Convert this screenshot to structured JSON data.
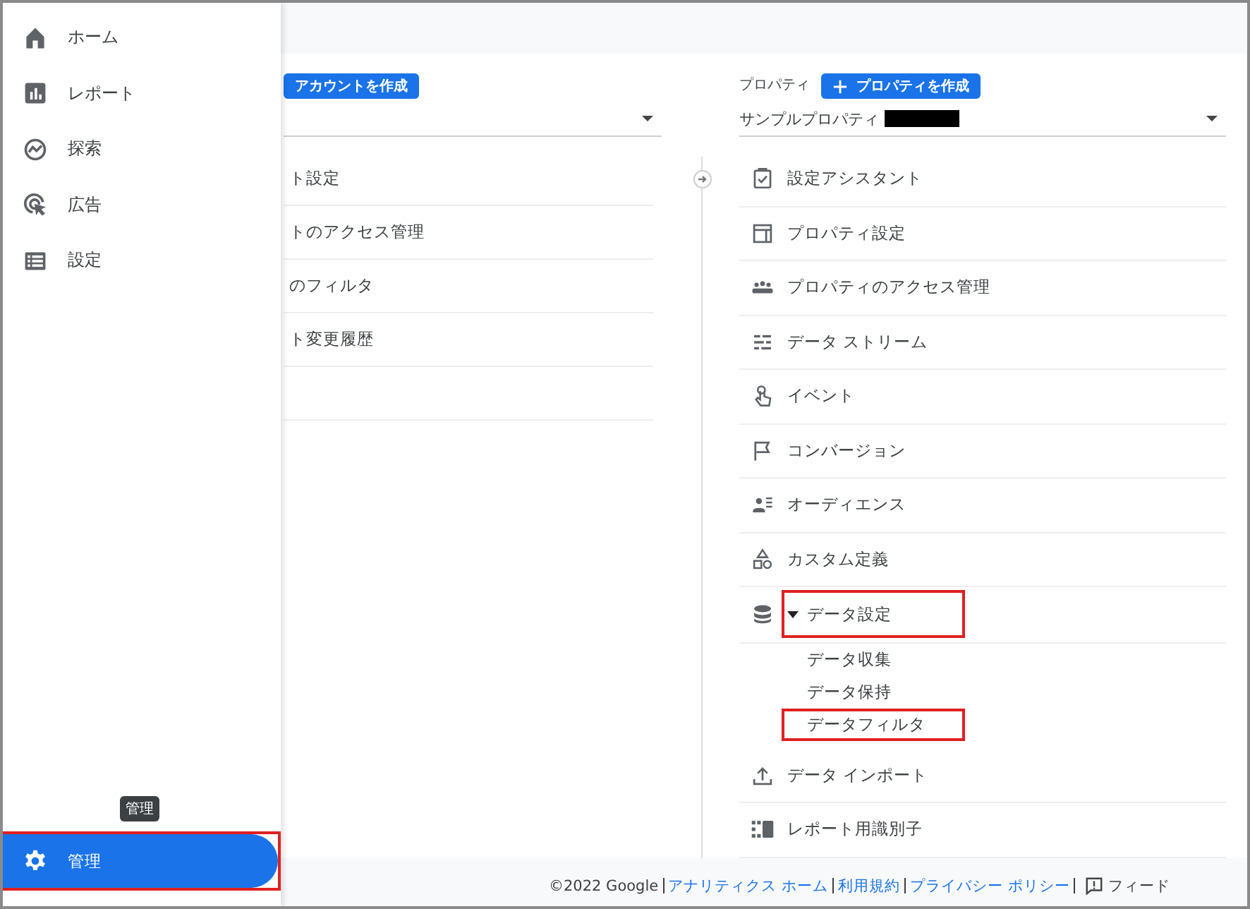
{
  "sidebar": {
    "items": [
      {
        "label": "ホーム"
      },
      {
        "label": "レポート"
      },
      {
        "label": "探索"
      },
      {
        "label": "広告"
      },
      {
        "label": "設定"
      }
    ],
    "admin": {
      "label": "管理",
      "selected": true,
      "highlighted": true,
      "tooltip": "管理"
    }
  },
  "account": {
    "create_button": "アカウントを作成",
    "items": [
      "ト設定",
      "トのアクセス管理",
      "のフィルタ",
      "ト変更履歴"
    ]
  },
  "property": {
    "label": "プロパティ",
    "create_button": "プロパティを作成",
    "selector": "サンプルプロパティ",
    "items": [
      {
        "label": "設定アシスタント",
        "expanded": false,
        "highlighted": false
      },
      {
        "label": "プロパティ設定",
        "expanded": false,
        "highlighted": false
      },
      {
        "label": "プロパティのアクセス管理",
        "expanded": false,
        "highlighted": false
      },
      {
        "label": "データ ストリーム",
        "expanded": false,
        "highlighted": false
      },
      {
        "label": "イベント",
        "expanded": false,
        "highlighted": false
      },
      {
        "label": "コンバージョン",
        "expanded": false,
        "highlighted": false
      },
      {
        "label": "オーディエンス",
        "expanded": false,
        "highlighted": false
      },
      {
        "label": "カスタム定義",
        "expanded": false,
        "highlighted": false
      },
      {
        "label": "データ設定",
        "expanded": true,
        "highlighted": true,
        "children": [
          {
            "label": "データ収集",
            "highlighted": false
          },
          {
            "label": "データ保持",
            "highlighted": false
          },
          {
            "label": "データフィルタ",
            "highlighted": true
          }
        ]
      },
      {
        "label": "データ インポート",
        "expanded": false,
        "highlighted": false
      },
      {
        "label": "レポート用識別子",
        "expanded": false,
        "highlighted": false
      }
    ]
  },
  "footer": {
    "copyright": "©2022 Google",
    "links": [
      "アナリティクス ホーム",
      "利用規約",
      "プライバシー ポリシー"
    ],
    "feedback": "フィード"
  }
}
